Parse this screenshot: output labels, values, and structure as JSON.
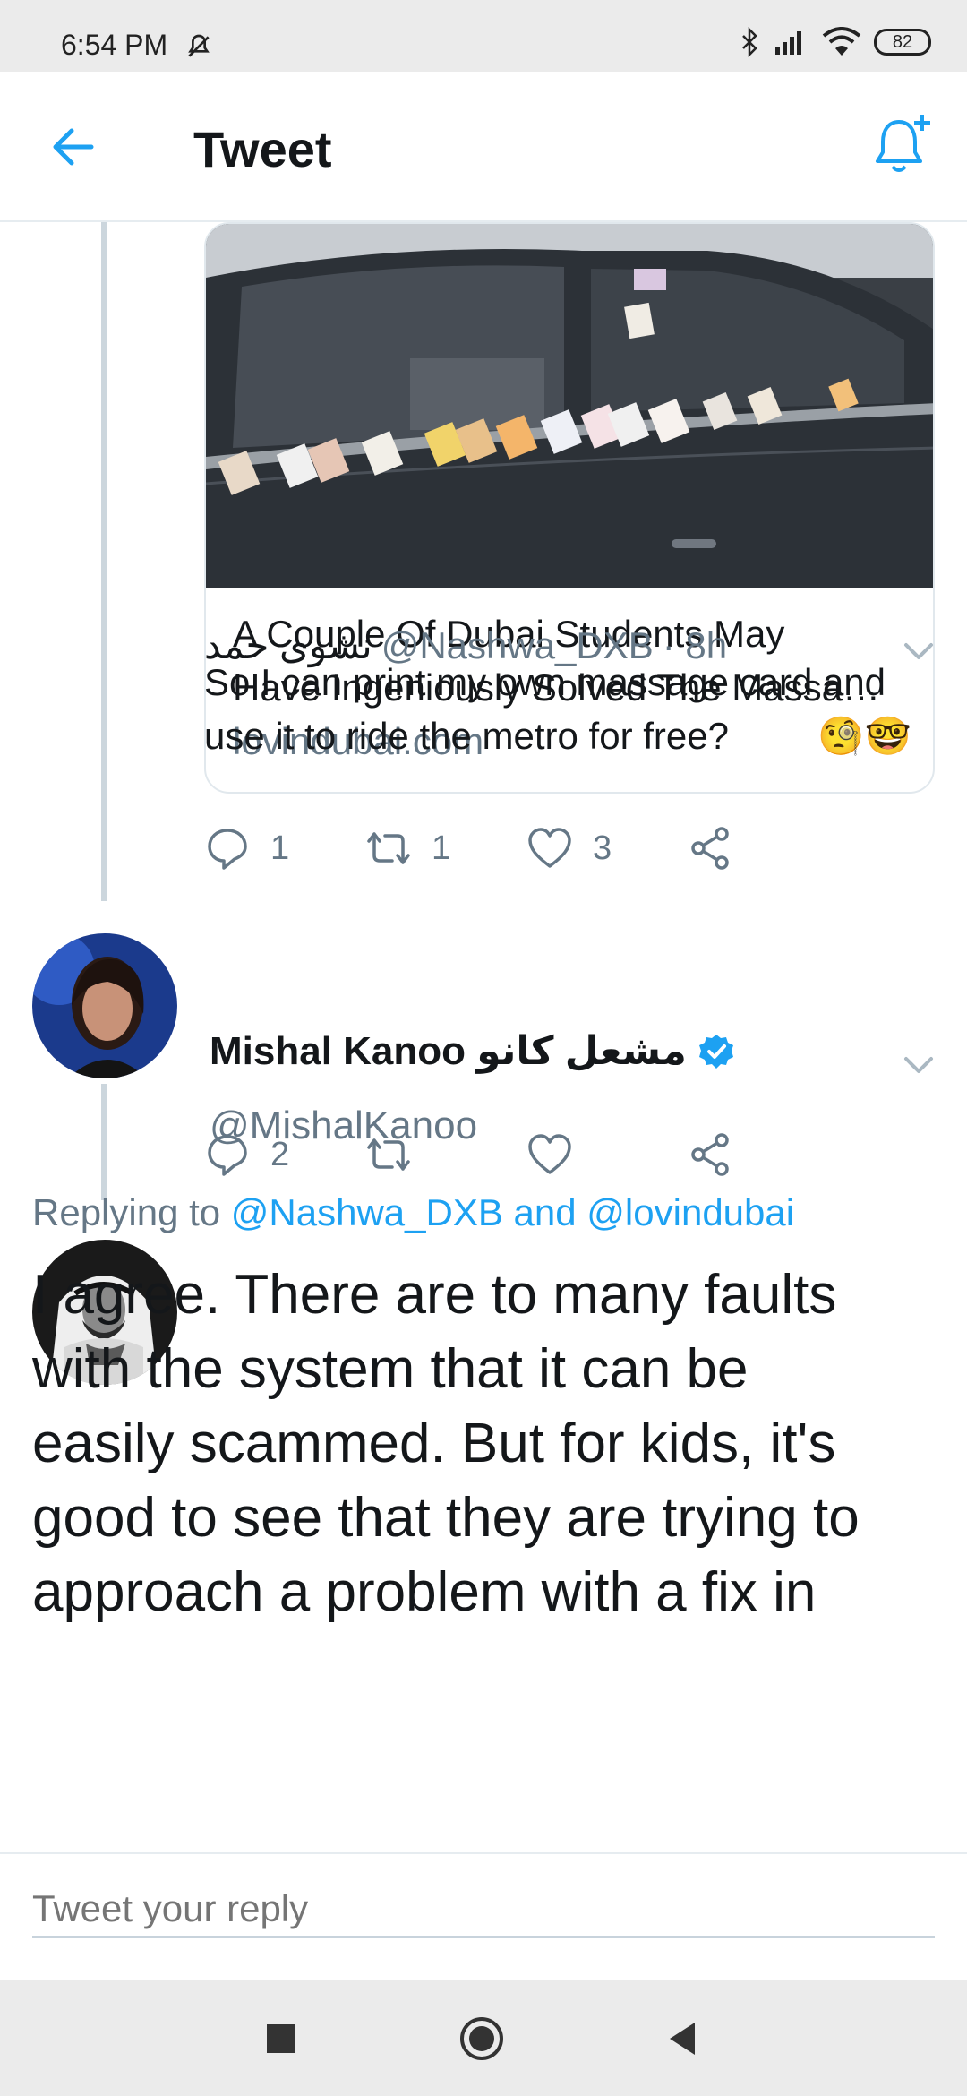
{
  "status_bar": {
    "time": "6:54 PM",
    "battery": "82"
  },
  "header": {
    "title": "Tweet"
  },
  "link_card": {
    "title_line1": "A Couple Of Dubai Students May",
    "title_line2": "Have Ingeniously Solved The Massa…",
    "domain": "lovindubai.com"
  },
  "card_actions": {
    "replies": "1",
    "retweets": "1",
    "likes": "3"
  },
  "reply_tweet": {
    "display_name": "نشوى حمد",
    "handle": "@Nashwa_DXB",
    "time": "· 8h",
    "text_line1": "So I can print my own massage card and",
    "text_line2": "use it to ride the metro for free?",
    "emojis": "🧐🤓"
  },
  "reply_actions": {
    "replies": "2",
    "retweets": "",
    "likes": ""
  },
  "main_tweet": {
    "display_name": "Mishal Kanoo مشعل كانو",
    "handle": "@MishalKanoo",
    "replying_prefix": "Replying to",
    "replying_targets": "@Nashwa_DXB and @lovindubai",
    "text_line1": "I agree. There are to many faults",
    "text_line2": "with the system that it can be",
    "text_line3": "easily scammed. But for kids, it's",
    "text_line4": "good to see that they are trying to",
    "text_line5": "approach a problem with a fix in"
  },
  "composer": {
    "placeholder": "Tweet your reply"
  },
  "colors": {
    "accent": "#1da1f2",
    "muted": "#657786",
    "text": "#14171a"
  }
}
